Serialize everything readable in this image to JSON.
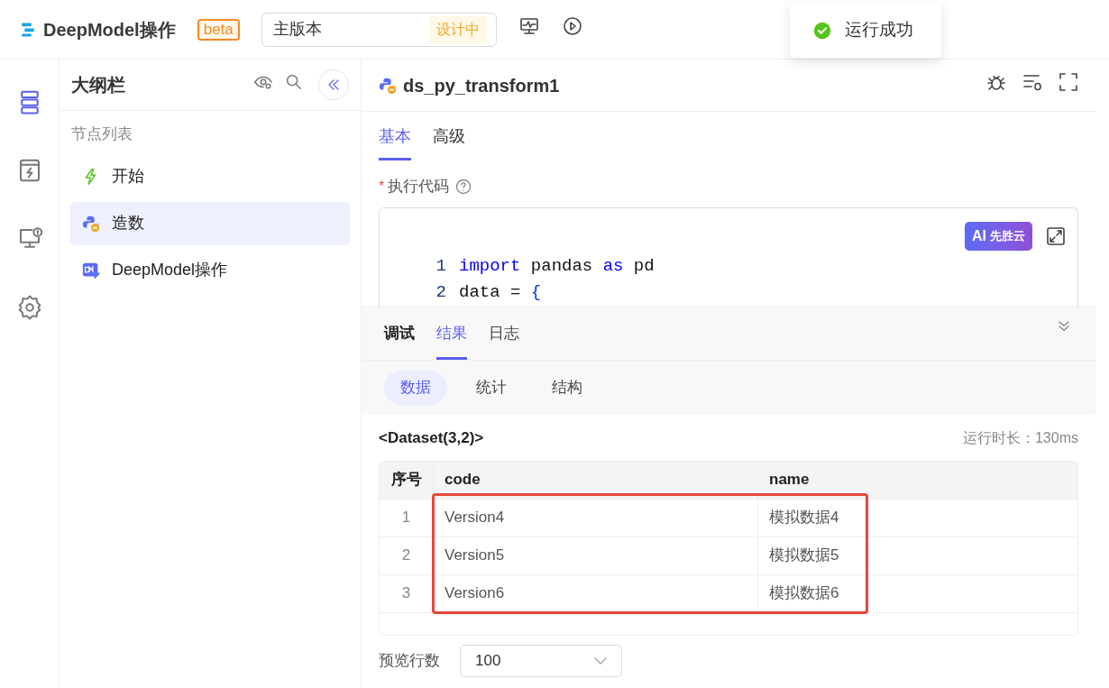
{
  "header": {
    "app_name": "DeepModel操作",
    "badge": "beta",
    "version": {
      "value": "主版本",
      "status": "设计中"
    }
  },
  "toast": {
    "message": "运行成功"
  },
  "rail": [
    {
      "kind": "outline",
      "selected": true
    },
    {
      "kind": "box",
      "selected": false
    },
    {
      "kind": "monitor",
      "selected": false
    },
    {
      "kind": "settings",
      "selected": false
    }
  ],
  "outline": {
    "title": "大纲栏",
    "section": "节点列表",
    "nodes": [
      {
        "label": "开始",
        "kind": "start",
        "selected": false
      },
      {
        "label": "造数",
        "kind": "python",
        "selected": true
      },
      {
        "label": "DeepModel操作",
        "kind": "deepmodel",
        "selected": false
      }
    ]
  },
  "editor": {
    "title": "ds_py_transform1",
    "tabs": [
      {
        "label": "基本",
        "selected": true
      },
      {
        "label": "高级",
        "selected": false
      }
    ],
    "field_label": "执行代码",
    "required_mark": "*",
    "ai_button": "先胜云",
    "ai_prefix": "AI",
    "code": [
      {
        "number": "1",
        "tokens": [
          {
            "text": "import",
            "kind": "keyword"
          },
          {
            "text": " pandas ",
            "kind": "plain"
          },
          {
            "text": "as",
            "kind": "keyword"
          },
          {
            "text": " pd",
            "kind": "plain"
          }
        ]
      },
      {
        "number": "2",
        "tokens": [
          {
            "text": "data = ",
            "kind": "plain"
          },
          {
            "text": "{",
            "kind": "brace"
          }
        ]
      }
    ]
  },
  "debug": {
    "title": "调试",
    "tabs": [
      {
        "label": "结果",
        "selected": true
      },
      {
        "label": "日志",
        "selected": false
      }
    ],
    "subtabs": [
      {
        "label": "数据",
        "selected": true
      },
      {
        "label": "统计",
        "selected": false
      },
      {
        "label": "结构",
        "selected": false
      }
    ],
    "dataset": "<Dataset(3,2)>",
    "runtime": "运行时长：130ms",
    "table": {
      "columns": [
        "序号",
        "code",
        "name"
      ],
      "rows": [
        [
          "1",
          "Version4",
          "模拟数据4"
        ],
        [
          "2",
          "Version5",
          "模拟数据5"
        ],
        [
          "3",
          "Version6",
          "模拟数据6"
        ]
      ]
    },
    "preview_label": "预览行数",
    "preview_value": "100"
  }
}
